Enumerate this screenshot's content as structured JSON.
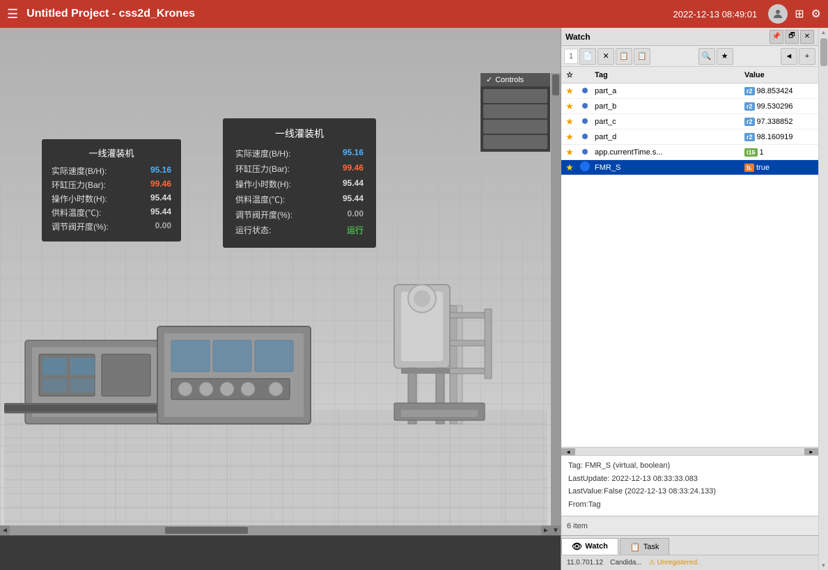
{
  "titleBar": {
    "title": "Untitled Project - css2d_Krones",
    "datetime": "2022-12-13  08:49:01",
    "menuIcon": "☰",
    "gridIcon": "⊞",
    "settingsIcon": "⚙"
  },
  "viewport": {
    "controls": {
      "label": "✓ Controls"
    },
    "scrollUpLabel": "▲",
    "scrollDownLabel": "▼",
    "scrollLeftLabel": "◄",
    "scrollRightLabel": "►"
  },
  "popupSmall": {
    "title": "一线灌装机",
    "rows": [
      {
        "label": "实际速度(B/H):",
        "value": "95.16",
        "color": "blue"
      },
      {
        "label": "环缸压力(Bar):",
        "value": "99.46",
        "color": "orange"
      },
      {
        "label": "操作小时数(H):",
        "value": "95.44",
        "color": "default"
      },
      {
        "label": "供料温度(℃):",
        "value": "95.44",
        "color": "default"
      },
      {
        "label": "调节阀开度(%):",
        "value": "0.00",
        "color": "gray"
      }
    ]
  },
  "popupLarge": {
    "title": "一线灌装机",
    "rows": [
      {
        "label": "实际速度(B/H):",
        "value": "95.16",
        "color": "blue"
      },
      {
        "label": "环缸压力(Bar):",
        "value": "99.46",
        "color": "orange"
      },
      {
        "label": "操作小时数(H):",
        "value": "95.44",
        "color": "default"
      },
      {
        "label": "供料温度(℃):",
        "value": "95.44",
        "color": "default"
      },
      {
        "label": "调节阀开度(%):",
        "value": "0.00",
        "color": "gray"
      },
      {
        "label": "运行状态:",
        "value": "运行",
        "color": "green"
      }
    ]
  },
  "watchPanel": {
    "title": "Watch",
    "toolbar": {
      "rowNum": "1"
    },
    "tableHeaders": {
      "star": "☆",
      "tag": "Tag",
      "value": "Value"
    },
    "rows": [
      {
        "id": 1,
        "starred": true,
        "dotColor": "#4472c4",
        "tag": "part_a",
        "typeBadge": "r2",
        "value": "98.853424",
        "selected": false,
        "highlighted": false
      },
      {
        "id": 2,
        "starred": true,
        "dotColor": "#4472c4",
        "tag": "part_b",
        "typeBadge": "r2",
        "value": "99.530296",
        "selected": false,
        "highlighted": false
      },
      {
        "id": 3,
        "starred": true,
        "dotColor": "#4472c4",
        "tag": "part_c",
        "typeBadge": "r2",
        "value": "97.338852",
        "selected": false,
        "highlighted": false
      },
      {
        "id": 4,
        "starred": true,
        "dotColor": "#4472c4",
        "tag": "part_d",
        "typeBadge": "r2",
        "value": "98.160919",
        "selected": false,
        "highlighted": false
      },
      {
        "id": 5,
        "starred": true,
        "dotColor": "#4472c4",
        "tag": "app.currentTime.s...",
        "typeBadge": "i16",
        "value": "1",
        "selected": false,
        "highlighted": false
      },
      {
        "id": 6,
        "starred": true,
        "dotColor": "#1e6ef0",
        "tag": "FMR_S",
        "typeBadge": "bool",
        "value": "true",
        "selected": true,
        "highlighted": true
      }
    ],
    "detail": {
      "tagInfo": "Tag: FMR_S (virtual, boolean)",
      "lastUpdate": "LastUpdate: 2022-12-13 08:33:33.083",
      "lastValue": "LastValue:False (2022-12-13 08:33:24.133)",
      "from": "From:Tag"
    },
    "itemCount": "6 item",
    "tabs": [
      {
        "id": "watch",
        "label": "Watch",
        "icon": "👁",
        "active": true
      },
      {
        "id": "task",
        "label": "Task",
        "icon": "📋",
        "active": false
      }
    ]
  },
  "bottomStatus": {
    "version": "11.0.701.12",
    "candidate": "Candida...",
    "warningText": "Unregistered."
  }
}
